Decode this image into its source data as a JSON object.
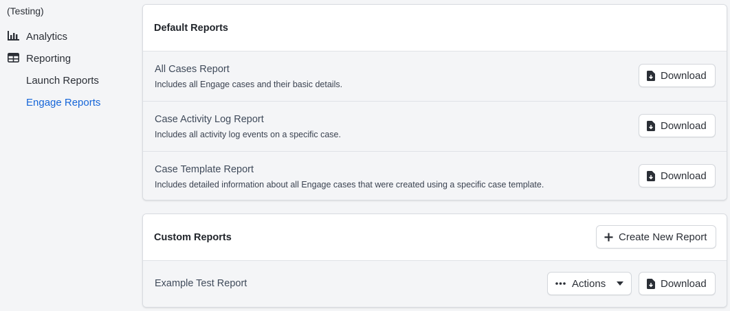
{
  "sidebar": {
    "org_name": "(Testing)",
    "items": [
      {
        "label": "Analytics",
        "icon": "bar-chart-icon"
      },
      {
        "label": "Reporting",
        "icon": "table-icon"
      }
    ],
    "sub_items": [
      {
        "label": "Launch Reports",
        "active": false
      },
      {
        "label": "Engage Reports",
        "active": true
      }
    ],
    "active_color": "#1565d8"
  },
  "default_reports": {
    "title": "Default Reports",
    "rows": [
      {
        "title": "All Cases Report",
        "description": "Includes all Engage cases and their basic details.",
        "button": "Download"
      },
      {
        "title": "Case Activity Log Report",
        "description": "Includes all activity log events on a specific case.",
        "button": "Download"
      },
      {
        "title": "Case Template Report",
        "description": "Includes detailed information about all Engage cases that were created using a specific case template.",
        "button": "Download"
      }
    ]
  },
  "custom_reports": {
    "title": "Custom Reports",
    "create_button": "Create New Report",
    "rows": [
      {
        "title": "Example Test Report",
        "actions_button": "Actions",
        "download_button": "Download"
      }
    ]
  }
}
